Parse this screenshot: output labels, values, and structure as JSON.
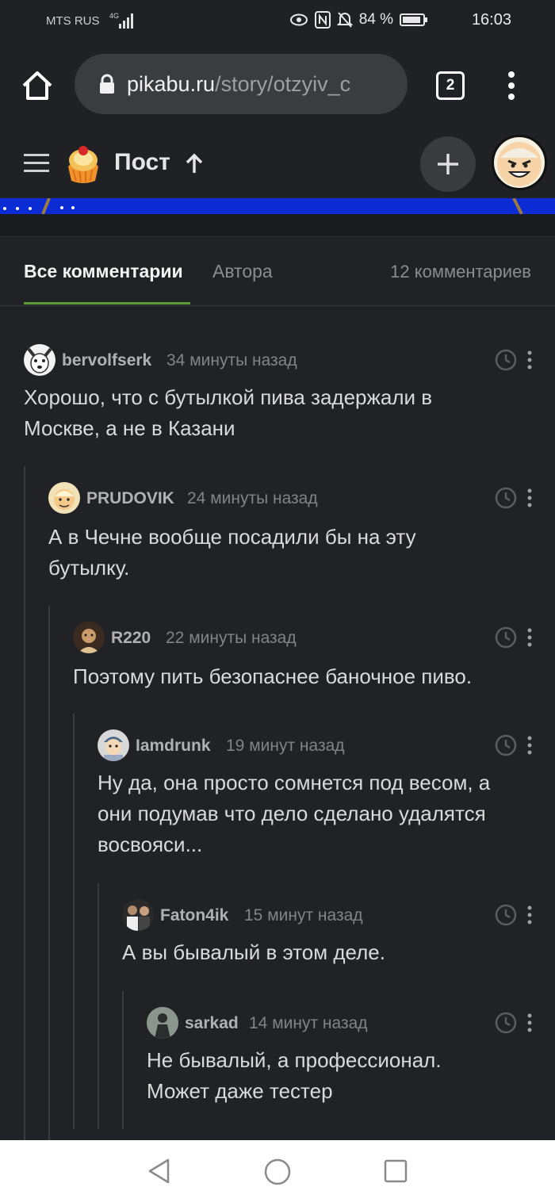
{
  "status_bar": {
    "carrier": "MTS RUS",
    "network": "4G",
    "battery": "84 %",
    "time": "16:03"
  },
  "browser": {
    "url_host": "pikabu.ru",
    "url_path": "/story/otzyiv_c",
    "tab_count": "2"
  },
  "app_header": {
    "title": "Пост"
  },
  "tabs": {
    "all_comments": "Все комментарии",
    "author": "Автора",
    "count": "12 комментариев"
  },
  "comments": [
    {
      "user": "bervolfserk",
      "time": "34 минуты назад",
      "text_lines": [
        "Хорошо, что с бутылкой пива задержали в",
        "Москве, а не в Казани"
      ]
    },
    {
      "user": "PRUDOVIK",
      "time": "24 минуты назад",
      "text_lines": [
        "А в Чечне вообще посадили бы на эту",
        "бутылку."
      ]
    },
    {
      "user": "R220",
      "time": "22 минуты назад",
      "text_lines": [
        "Поэтому пить безопаснее баночное пиво."
      ]
    },
    {
      "user": "Iamdrunk",
      "time": "19 минут назад",
      "text_lines": [
        "Ну да, она просто сомнется под весом, а",
        "они подумав что дело сделано удалятся",
        "восвояси..."
      ]
    },
    {
      "user": "Faton4ik",
      "time": "15 минут назад",
      "text_lines": [
        "А вы бывалый в этом деле."
      ]
    },
    {
      "user": "sarkad",
      "time": "14 минут назад",
      "text_lines": [
        "Не бывалый, а профессионал.",
        "Может даже тестер"
      ]
    }
  ],
  "colors": {
    "background": "#212226",
    "accent_green": "#5c9b38",
    "banner_blue": "#0b2bd4"
  }
}
